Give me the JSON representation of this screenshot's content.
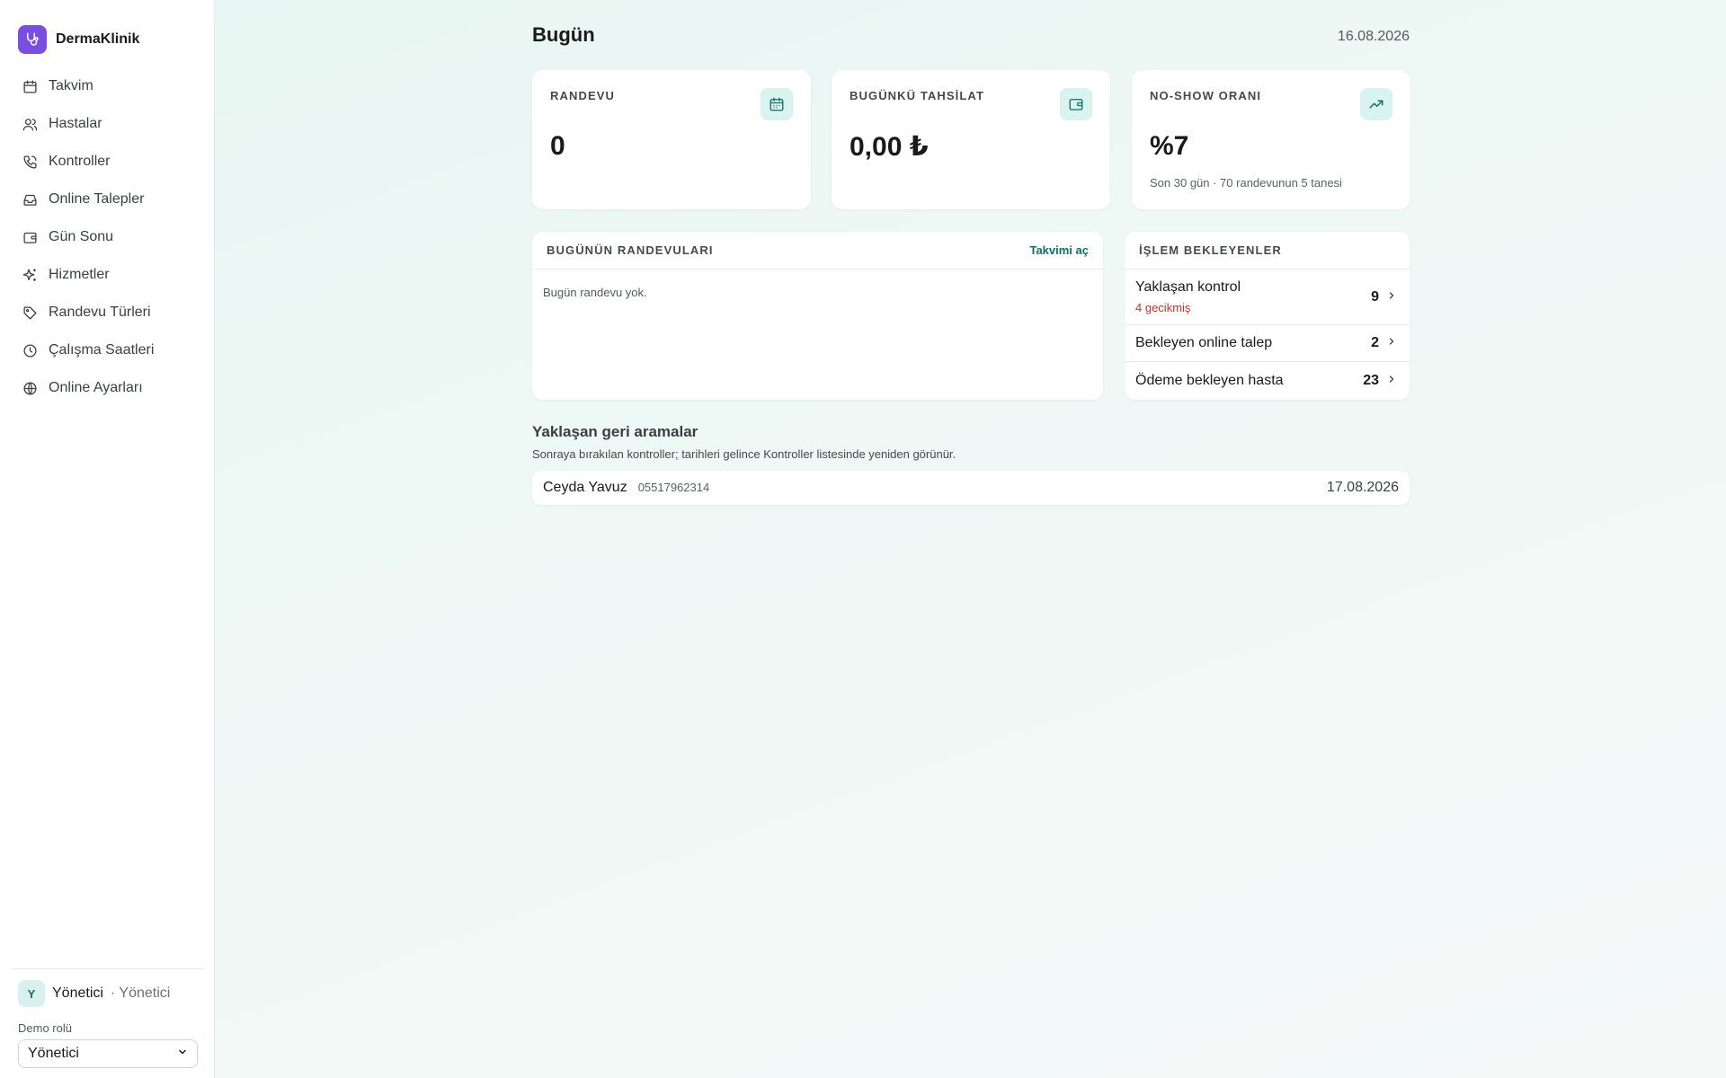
{
  "app": {
    "brand": "DermaKlinik"
  },
  "sidebar": {
    "items": [
      {
        "label": "Takvim",
        "icon": "calendar-icon"
      },
      {
        "label": "Hastalar",
        "icon": "users-icon"
      },
      {
        "label": "Kontroller",
        "icon": "phone-icon"
      },
      {
        "label": "Online Talepler",
        "icon": "inbox-icon"
      },
      {
        "label": "Gün Sonu",
        "icon": "wallet-icon"
      },
      {
        "label": "Hizmetler",
        "icon": "sparkles-icon"
      },
      {
        "label": "Randevu Türleri",
        "icon": "tag-icon"
      },
      {
        "label": "Çalışma Saatleri",
        "icon": "clock-icon"
      },
      {
        "label": "Online Ayarları",
        "icon": "globe-icon"
      }
    ],
    "user": {
      "initial": "Y",
      "name": "Yönetici",
      "role": "· Yönetici"
    },
    "demo_role": {
      "label": "Demo rolü",
      "selected": "Yönetici"
    }
  },
  "header": {
    "title": "Bugün",
    "date": "16.08.2026"
  },
  "stats": [
    {
      "label": "RANDEVU",
      "value": "0",
      "sub": "",
      "icon": "calendar-icon"
    },
    {
      "label": "BUGÜNKÜ TAHSİLAT",
      "value": "0,00 ₺",
      "sub": "",
      "icon": "wallet-icon"
    },
    {
      "label": "NO-SHOW ORANI",
      "value": "%7",
      "sub": "Son 30 gün · 70 randevunun 5 tanesi",
      "icon": "trending-up-icon"
    }
  ],
  "appointments": {
    "title": "BUGÜNÜN RANDEVULARI",
    "link": "Takvimi aç",
    "empty": "Bugün randevu yok."
  },
  "pending": {
    "title": "İŞLEM BEKLEYENLER",
    "rows": [
      {
        "label": "Yaklaşan kontrol",
        "note": "4 gecikmiş",
        "count": "9"
      },
      {
        "label": "Bekleyen online talep",
        "note": "",
        "count": "2"
      },
      {
        "label": "Ödeme bekleyen hasta",
        "note": "",
        "count": "23"
      }
    ]
  },
  "callbacks": {
    "title": "Yaklaşan geri aramalar",
    "subtitle": "Sonraya bırakılan kontroller; tarihleri gelince Kontroller listesinde yeniden görünür.",
    "rows": [
      {
        "name": "Ceyda Yavuz",
        "phone": "05517962314",
        "date": "17.08.2026"
      }
    ]
  },
  "colors": {
    "accent": "#136e66",
    "brand": "#7a4fe0",
    "warning": "#c0352b",
    "icon_bg": "#d9f3f0"
  }
}
